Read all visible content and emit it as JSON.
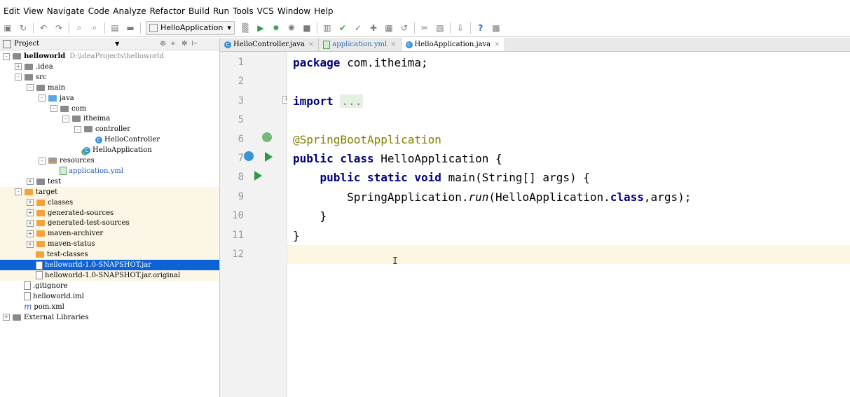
{
  "menu": [
    "Edit",
    "View",
    "Navigate",
    "Code",
    "Analyze",
    "Refactor",
    "Build",
    "Run",
    "Tools",
    "VCS",
    "Window",
    "Help"
  ],
  "toolbar": {
    "icons": [
      "save-icon",
      "sync-icon",
      "undo-icon",
      "redo-icon",
      "find-icon",
      "replace-icon",
      "copy-icon",
      "folder-icon",
      "build-icon",
      "run-icon",
      "debug-icon",
      "coverage-icon",
      "stop-icon",
      "sdk-icon",
      "vcs-update-icon",
      "vcs-commit-icon",
      "vcs-push-icon",
      "vcs-diff-icon",
      "vcs-revert-icon",
      "settings-icon",
      "structure-icon",
      "download-icon",
      "help-icon",
      "terminal-icon"
    ],
    "run_config": "HelloApplication",
    "help_label": "?"
  },
  "project_panel": {
    "title": "Project",
    "header_icons": [
      "locate-icon",
      "collapse-icon",
      "gear-icon",
      "hide-icon"
    ],
    "tree": [
      {
        "label": "helloworld",
        "path": "D:\\ideaProjects\\helloworld",
        "bold": true,
        "type": "module",
        "expand": "-"
      },
      {
        "label": ".idea",
        "type": "folder",
        "expand": "+"
      },
      {
        "label": "src",
        "type": "folder",
        "expand": "-"
      },
      {
        "label": "main",
        "type": "folder",
        "expand": "-"
      },
      {
        "label": "java",
        "type": "folder-blue",
        "expand": "-"
      },
      {
        "label": "com",
        "type": "package",
        "expand": "-"
      },
      {
        "label": "itheima",
        "type": "package",
        "expand": "-"
      },
      {
        "label": "controller",
        "type": "package",
        "expand": "-"
      },
      {
        "label": "HelloController",
        "type": "class"
      },
      {
        "label": "HelloApplication",
        "type": "spring-class"
      },
      {
        "label": "resources",
        "type": "folder-res",
        "expand": "-"
      },
      {
        "label": "application.yml",
        "type": "yml"
      },
      {
        "label": "test",
        "type": "folder",
        "expand": "+"
      },
      {
        "label": "target",
        "type": "folder-orange",
        "expand": "-",
        "target": true
      },
      {
        "label": "classes",
        "type": "folder-orange",
        "expand": "+",
        "target": true
      },
      {
        "label": "generated-sources",
        "type": "folder-orange",
        "expand": "+",
        "target": true
      },
      {
        "label": "generated-test-sources",
        "type": "folder-orange",
        "expand": "+",
        "target": true
      },
      {
        "label": "maven-archiver",
        "type": "folder-orange",
        "expand": "+",
        "target": true
      },
      {
        "label": "maven-status",
        "type": "folder-orange",
        "expand": "+",
        "target": true
      },
      {
        "label": "test-classes",
        "type": "folder-orange",
        "target": true
      },
      {
        "label": "helloworld-1.0-SNAPSHOT.jar",
        "type": "jar",
        "selected": true
      },
      {
        "label": "helloworld-1.0-SNAPSHOT.jar.original",
        "type": "file",
        "target": true
      },
      {
        "label": ".gitignore",
        "type": "file"
      },
      {
        "label": "helloworld.iml",
        "type": "file"
      },
      {
        "label": "pom.xml",
        "type": "maven"
      },
      {
        "label": "External Libraries",
        "type": "libs",
        "expand": "+"
      }
    ]
  },
  "tabs": [
    {
      "label": "HelloController.java",
      "icon": "class-icon",
      "active": false
    },
    {
      "label": "application.yml",
      "icon": "yml-icon",
      "active": false
    },
    {
      "label": "HelloApplication.java",
      "icon": "spring-class-icon",
      "active": true
    }
  ],
  "editor": {
    "lines": [
      {
        "n": "1",
        "code": [
          {
            "t": "package ",
            "c": "kw"
          },
          {
            "t": "com.itheima;"
          }
        ]
      },
      {
        "n": "2",
        "code": []
      },
      {
        "n": "3",
        "code": [
          {
            "t": "import ",
            "c": "kw"
          },
          {
            "t": "...",
            "c": "fold-dots"
          }
        ]
      },
      {
        "n": "5",
        "code": []
      },
      {
        "n": "6",
        "code": [
          {
            "t": "@SpringBootApplication",
            "c": "ann"
          }
        ]
      },
      {
        "n": "7",
        "code": [
          {
            "t": "public class ",
            "c": "kw"
          },
          {
            "t": "HelloApplication {"
          }
        ]
      },
      {
        "n": "8",
        "code": [
          {
            "t": "    "
          },
          {
            "t": "public static void ",
            "c": "kw"
          },
          {
            "t": "main(String[] args) {"
          }
        ]
      },
      {
        "n": "9",
        "code": [
          {
            "t": "        SpringApplication."
          },
          {
            "t": "run",
            "c": "it"
          },
          {
            "t": "(HelloApplication."
          },
          {
            "t": "class",
            "c": "kw"
          },
          {
            "t": ",args);"
          }
        ]
      },
      {
        "n": "10",
        "code": [
          {
            "t": "    }"
          }
        ]
      },
      {
        "n": "11",
        "code": [
          {
            "t": "}"
          }
        ]
      },
      {
        "n": "12",
        "code": [],
        "current": true
      }
    ]
  }
}
